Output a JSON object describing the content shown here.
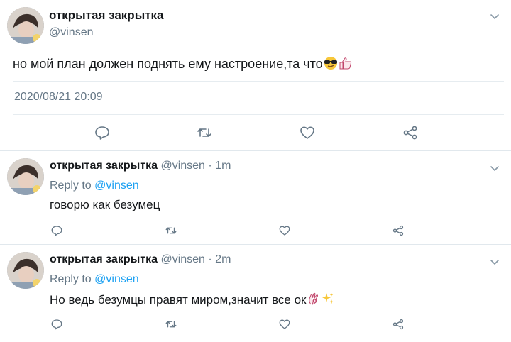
{
  "main_tweet": {
    "display_name": "открытая закрытка",
    "handle": "@vinsen",
    "text": "но мой план должен поднять ему настроение,та что",
    "emojis": [
      "sunglasses-face",
      "thumbs-up"
    ],
    "timestamp": "2020/08/21 20:09"
  },
  "replies": [
    {
      "display_name": "открытая закрытка",
      "meta": "@vinsen · 1m",
      "reply_prefix": "Reply to ",
      "reply_to": "@vinsen",
      "text": "говорю как безумец",
      "emojis": []
    },
    {
      "display_name": "открытая закрытка",
      "meta": "@vinsen · 2m",
      "reply_prefix": "Reply to ",
      "reply_to": "@vinsen",
      "text": "Но ведь безумцы правят миром,значит все ок",
      "emojis": [
        "ok-hand",
        "sparkles"
      ]
    }
  ],
  "icons": [
    "reply-icon",
    "retweet-icon",
    "like-icon",
    "share-icon",
    "chevron-down-icon"
  ],
  "colors": {
    "text": "#14171a",
    "muted": "#657786",
    "link": "#1da1f2",
    "divider": "#e6ecf0",
    "icon": "#657786"
  }
}
